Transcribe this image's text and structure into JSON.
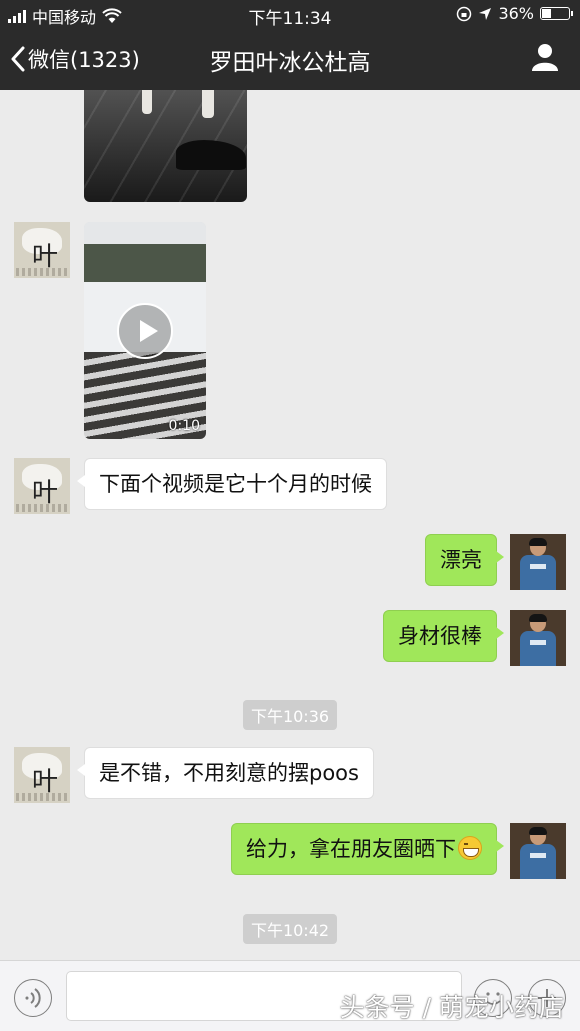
{
  "status_bar": {
    "carrier": "中国移动",
    "time": "下午11:34",
    "battery": "36%",
    "battery_level": 0.36
  },
  "nav": {
    "back_label": "微信(1323)",
    "title": "罗田叶冰公杜高"
  },
  "messages": {
    "video_duration": "0:10",
    "m1": "下面个视频是它十个月的时候",
    "m2": "漂亮",
    "m3": "身材很棒",
    "m4": "是不错，不用刻意的摆poos",
    "m5": "给力，拿在朋友圈晒下",
    "emoji_name": "grin-emoji"
  },
  "timestamps": {
    "t1": "下午10:36",
    "t2": "下午10:42"
  },
  "watermark": "头条号 / 萌宠小药店",
  "colors": {
    "nav_background": "#2b2b2b",
    "chat_background": "#ebebeb",
    "outgoing_bubble": "#a0e75a",
    "incoming_bubble": "#ffffff"
  }
}
